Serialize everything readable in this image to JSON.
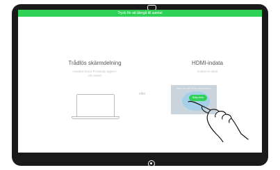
{
  "banner": {
    "text": "Tryck för att återgå till samtal"
  },
  "wireless": {
    "title": "Trådlös skärmdelning",
    "subtitle_line1": "Använd Cisco Proximity-appen i",
    "subtitle_line2": "din enhet"
  },
  "separator": {
    "text": "eller"
  },
  "hdmi": {
    "title": "HDMI-indata",
    "subtitle": "Anslut en dator",
    "preview_text": "Sätt in en dator för att dela din skärm",
    "share_button": "Börja dela"
  },
  "colors": {
    "accent": "#2fd157",
    "bezel": "#1a1a1a"
  },
  "icons": {
    "laptop": "laptop-icon",
    "hand": "hand-pointer-icon",
    "camera": "camera-icon",
    "home": "home-button-icon"
  }
}
